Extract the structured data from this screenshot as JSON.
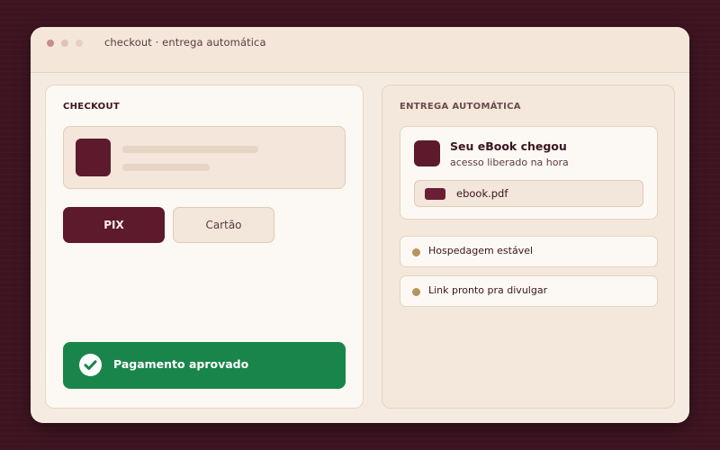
{
  "window": {
    "title": "checkout · entrega automática",
    "dots": [
      "#c98b93",
      "#e0c1bb",
      "#e7cfc6"
    ]
  },
  "checkout": {
    "section_label": "CHECKOUT",
    "payment_methods": [
      {
        "label": "PIX",
        "selected": true
      },
      {
        "label": "Cartão",
        "selected": false
      }
    ],
    "status": {
      "label": "Pagamento aprovado",
      "icon": "check-circle-icon"
    }
  },
  "delivery": {
    "section_label": "ENTREGA AUTOMÁTICA",
    "ebook": {
      "title": "Seu eBook chegou",
      "subtitle": "acesso liberado na hora",
      "file_name": "ebook.pdf"
    },
    "features": [
      {
        "label": "Hospedagem estável"
      },
      {
        "label": "Link pronto pra divulgar"
      }
    ]
  },
  "colors": {
    "brand": "#5c1a2c",
    "success": "#1a854a",
    "accent": "#b6955d",
    "background": "#3e1421"
  }
}
